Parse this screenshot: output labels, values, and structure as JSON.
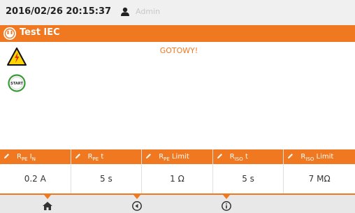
{
  "status_bar": {
    "datetime": "2016/02/26 20:15:37",
    "user": "Admin"
  },
  "title_bar": {
    "title": "Test IEC"
  },
  "main": {
    "status_message": "GOTOWY!",
    "start_label": "START"
  },
  "params": [
    {
      "label_main": "R",
      "label_sub": "PE",
      "label_rest": " I",
      "label_rest_sub": "N",
      "value": "0.2 A"
    },
    {
      "label_main": "R",
      "label_sub": "PE",
      "label_rest": " t",
      "label_rest_sub": "",
      "value": "5 s"
    },
    {
      "label_main": "R",
      "label_sub": "PE",
      "label_rest": " Limit",
      "label_rest_sub": "",
      "value": "1 Ω"
    },
    {
      "label_main": "R",
      "label_sub": "ISO",
      "label_rest": " t",
      "label_rest_sub": "",
      "value": "5 s"
    },
    {
      "label_main": "R",
      "label_sub": "ISO",
      "label_rest": " Limit",
      "label_rest_sub": "",
      "value": "7 MΩ"
    }
  ],
  "nav": {
    "items": [
      "home-icon",
      "back-icon",
      "info-icon"
    ]
  },
  "colors": {
    "accent": "#f07820",
    "status_bg": "#f0f0f0",
    "bottom_bg": "#e8e8e8"
  }
}
